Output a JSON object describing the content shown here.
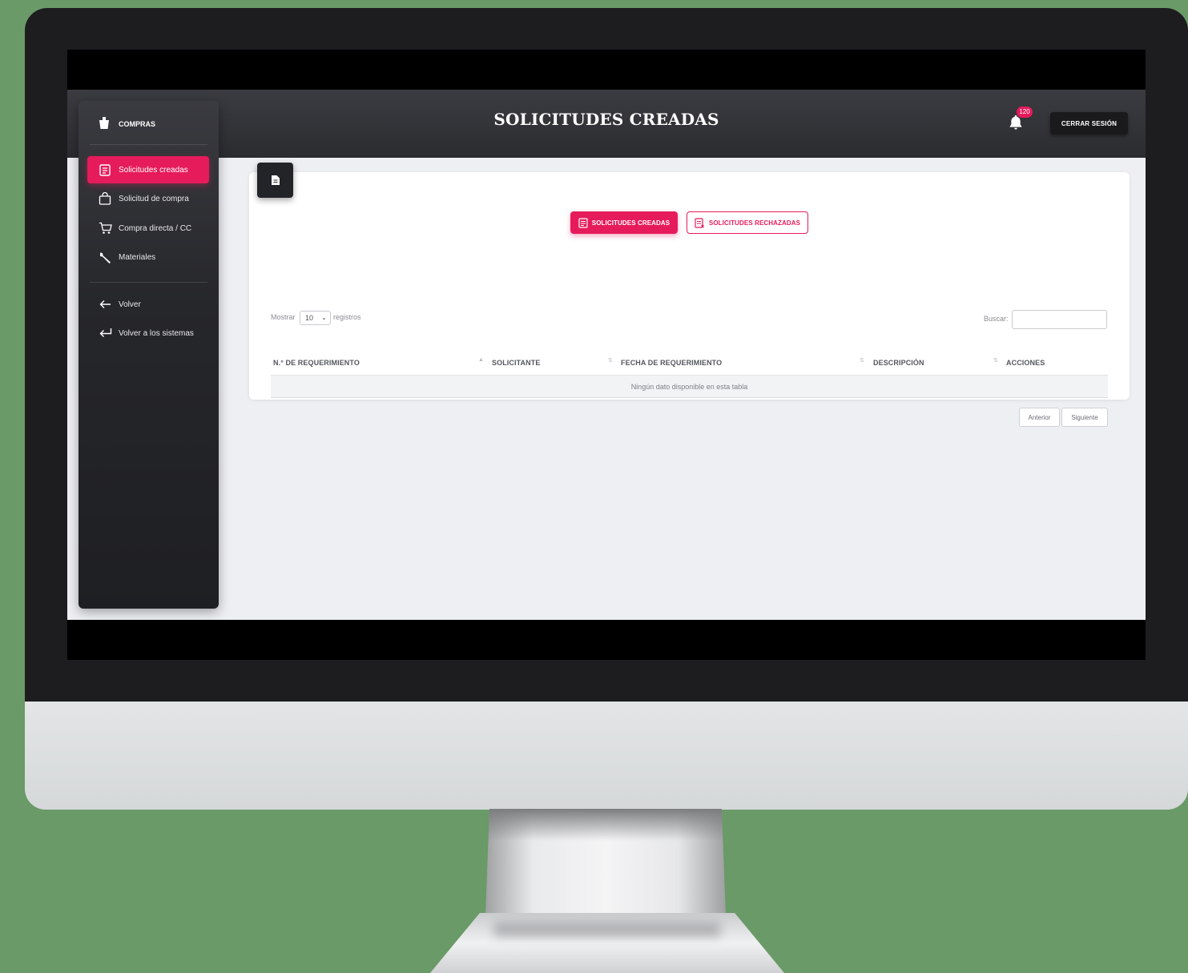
{
  "app": {
    "page_title": "SOLICITUDES CREADAS",
    "notification_count": "120",
    "logout_label": "CERRAR SESIÓN"
  },
  "sidebar": {
    "brand": "COMPRAS",
    "items": [
      {
        "label": "Solicitudes creadas",
        "icon": "document-list-icon",
        "active": true
      },
      {
        "label": "Solicitud de compra",
        "icon": "shopping-bag-icon",
        "active": false
      },
      {
        "label": "Compra directa / CC",
        "icon": "cart-icon",
        "active": false
      },
      {
        "label": "Materiales",
        "icon": "wrench-icon",
        "active": false
      }
    ],
    "secondary": [
      {
        "label": "Volver",
        "icon": "arrow-left-icon"
      },
      {
        "label": "Volver a los sistemas",
        "icon": "return-arrow-icon"
      }
    ]
  },
  "tabs": {
    "created": "SOLICITUDES CREADAS",
    "rejected": "SOLICITUDES RECHAZADAS"
  },
  "table": {
    "length_prefix": "Mostrar",
    "length_value": "10",
    "length_suffix": "registros",
    "search_label": "Buscar:",
    "search_value": "",
    "columns": [
      "N.° DE REQUERIMIENTO",
      "SOLICITANTE",
      "FECHA DE REQUERIMIENTO",
      "DESCRIPCIÓN",
      "ACCIONES"
    ],
    "empty_message": "Ningún dato disponible en esta tabla",
    "prev_label": "Anterior",
    "next_label": "Siguiente"
  },
  "colors": {
    "accent": "#e61b5b",
    "sidebar": "#26272b",
    "background": "#6a9a67"
  }
}
